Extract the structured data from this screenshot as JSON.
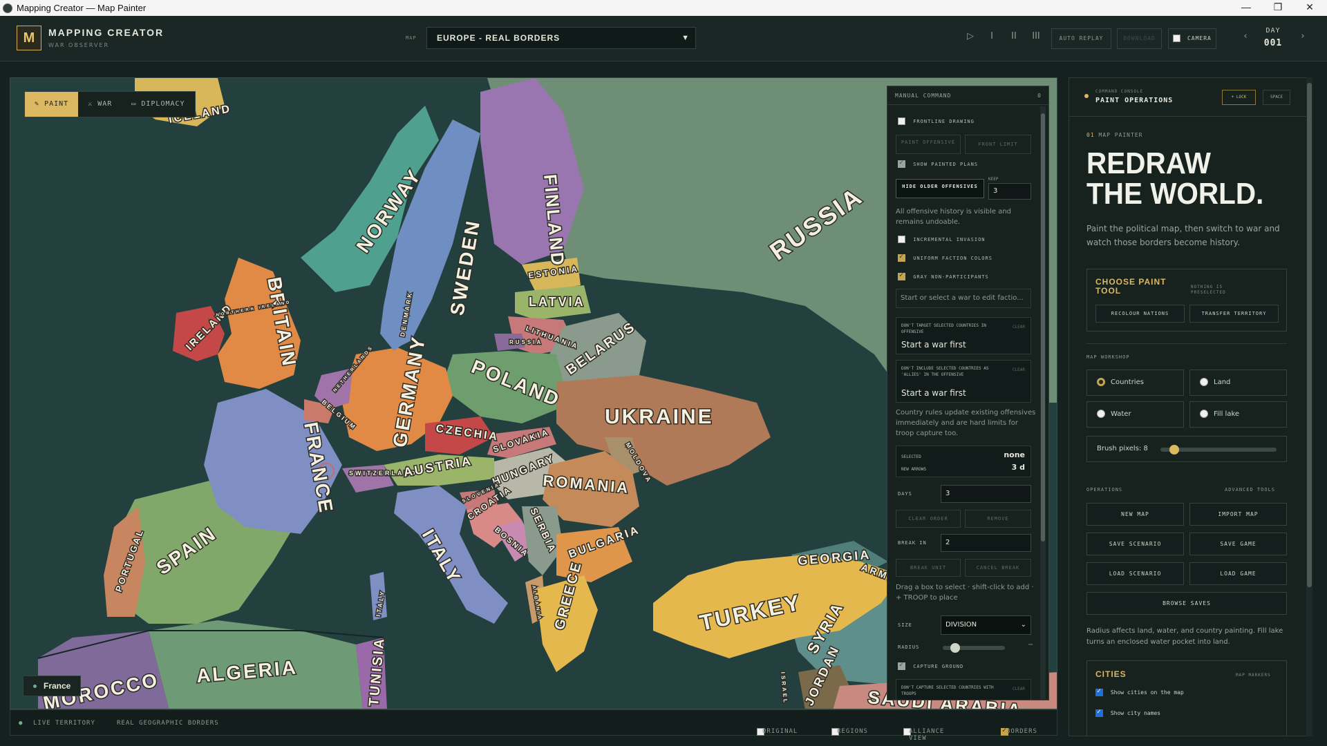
{
  "window": {
    "title": "Mapping Creator — Map Painter",
    "controls": [
      "—",
      "❐",
      "✕"
    ]
  },
  "app": {
    "logo": "M",
    "brand": "MAPPING CREATOR",
    "subtitle": "WAR OBSERVER"
  },
  "toolbar": {
    "map_label": "MAP",
    "map_value": "EUROPE - REAL BORDERS",
    "play": "▷",
    "speed1": "I",
    "speed2": "II",
    "speed3": "III",
    "auto_replay": "AUTO REPLAY",
    "download": "DOWNLOAD",
    "camera": "CAMERA",
    "prev": "‹",
    "next": "›",
    "day_label": "DAY",
    "day_value": "001"
  },
  "mode_tabs": [
    {
      "icon": "✎",
      "label": "PAINT",
      "active": true
    },
    {
      "icon": "⚔",
      "label": "WAR",
      "active": false
    },
    {
      "icon": "▭",
      "label": "DIPLOMACY",
      "active": false
    }
  ],
  "map": {
    "selected_country": "France",
    "labels": [
      "NORWAY",
      "SWEDEN",
      "FINLAND",
      "RUSSIA",
      "ESTONIA",
      "LATVIA",
      "LITHUANIA",
      "RUSSIA",
      "BELARUS",
      "DENMARK",
      "BRITAIN",
      "IRELAND",
      "NORTHERN IRELAND",
      "NETHERLANDS",
      "BELGIUM",
      "GERMANY",
      "POLAND",
      "CZECHIA",
      "SLOVAKIA",
      "UKRAINE",
      "MOLDOVA",
      "FRANCE",
      "SWITZERLAND",
      "AUSTRIA",
      "HUNGARY",
      "ROMANIA",
      "SLOVENIA",
      "CROATIA",
      "BOSNIA",
      "SERBIA",
      "BULGARIA",
      "ALBANIA",
      "GREECE",
      "ITALY",
      "ITALY",
      "SPAIN",
      "PORTUGAL",
      "TURKEY",
      "GEORGIA",
      "ARMENIA",
      "SYRIA",
      "ISRAEL",
      "JORDAN",
      "SAUDI ARABIA",
      "ALGERIA",
      "TUNISIA",
      "MOROCCO",
      "ICELAND"
    ]
  },
  "console": {
    "header": "MANUAL COMMAND",
    "count": "0",
    "frontline": "FRONTLINE DRAWING",
    "paint_offensive": "PAINT OFFENSIVE",
    "front_limit": "FRONT LIMIT",
    "show_painted": "SHOW PAINTED PLANS",
    "hide_older": "HIDE OLDER OFFENSIVES",
    "keep_label": "KEEP",
    "keep_value": "3",
    "history_note": "All offensive history is visible and remains undoable.",
    "incremental": "INCREMENTAL INVASION",
    "uniform": "UNIFORM FACTION COLORS",
    "gray": "GRAY NON-PARTICIPANTS",
    "war_placeholder": "Start or select a war to edit factio...",
    "dont_target": "DON'T TARGET SELECTED COUNTRIES IN OFFENSIVE",
    "clear": "CLEAR",
    "start_war_first": "Start a war first",
    "dont_include": "DON'T INCLUDE SELECTED COUNTRIES AS 'ALLIES' IN THE OFFENSIVE",
    "rules_note": "Country rules update existing offensives immediately and are hard limits for troop capture too.",
    "selected_label": "SELECTED",
    "selected_value": "none",
    "new_arrows_label": "NEW ARROWS",
    "new_arrows_value": "3 d",
    "days_label": "DAYS",
    "days_value": "3",
    "clear_order": "CLEAR ORDER",
    "remove": "REMOVE",
    "break_in_label": "BREAK IN",
    "break_in_value": "2",
    "break_unit": "BREAK UNIT",
    "cancel_break": "CANCEL BREAK",
    "drag_note": "Drag a box to select · shift-click to add · + TROOP to place",
    "size_label": "SIZE",
    "size_value": "DIVISION",
    "radius_label": "RADIUS",
    "radius_level": 0.12,
    "capture_ground": "CAPTURE GROUND",
    "dont_capture": "DON'T CAPTURE SELECTED COUNTRIES WITH TROOPS"
  },
  "right": {
    "console_label": "COMMAND CONSOLE",
    "panel_title": "PAINT OPERATIONS",
    "lock": "+ LOCK",
    "space": "SPACE",
    "kicker_num": "01",
    "kicker": "MAP PAINTER",
    "headline1": "REDRAW",
    "headline2": "THE WORLD.",
    "intro": "Paint the political map, then switch to war and watch those borders become history.",
    "choose_title": "CHOOSE PAINT TOOL",
    "nothing_pre": "NOTHING IS PRESELECTED",
    "recolour": "RECOLOUR NATIONS",
    "transfer": "TRANSFER TERRITORY",
    "workshop": "MAP WORKSHOP",
    "opt_countries": "Countries",
    "opt_land": "Land",
    "opt_water": "Water",
    "opt_fill": "Fill lake",
    "brush_label": "Brush pixels: 8",
    "brush_level": 0.08,
    "operations": "OPERATIONS",
    "advanced": "ADVANCED TOOLS",
    "new_map": "NEW MAP",
    "import_map": "IMPORT MAP",
    "save_scenario": "SAVE SCENARIO",
    "save_game": "SAVE GAME",
    "load_scenario": "LOAD SCENARIO",
    "load_game": "LOAD GAME",
    "browse": "BROWSE SAVES",
    "radius_note": "Radius affects land, water, and country painting. Fill lake turns an enclosed water pocket into land.",
    "cities": "CITIES",
    "map_markers": "MAP MARKERS",
    "show_cities": "Show cities on the map",
    "show_names": "Show city names"
  },
  "status": {
    "live": "LIVE TERRITORY",
    "real": "REAL GEOGRAPHIC BORDERS",
    "original": "ORIGINAL",
    "regions": "REGIONS",
    "alliance": "ALLIANCE VIEW",
    "borders": "BORDERS"
  },
  "colors": {
    "accent": "#dcb862",
    "sea": "#23403f",
    "panel": "#17221f"
  }
}
